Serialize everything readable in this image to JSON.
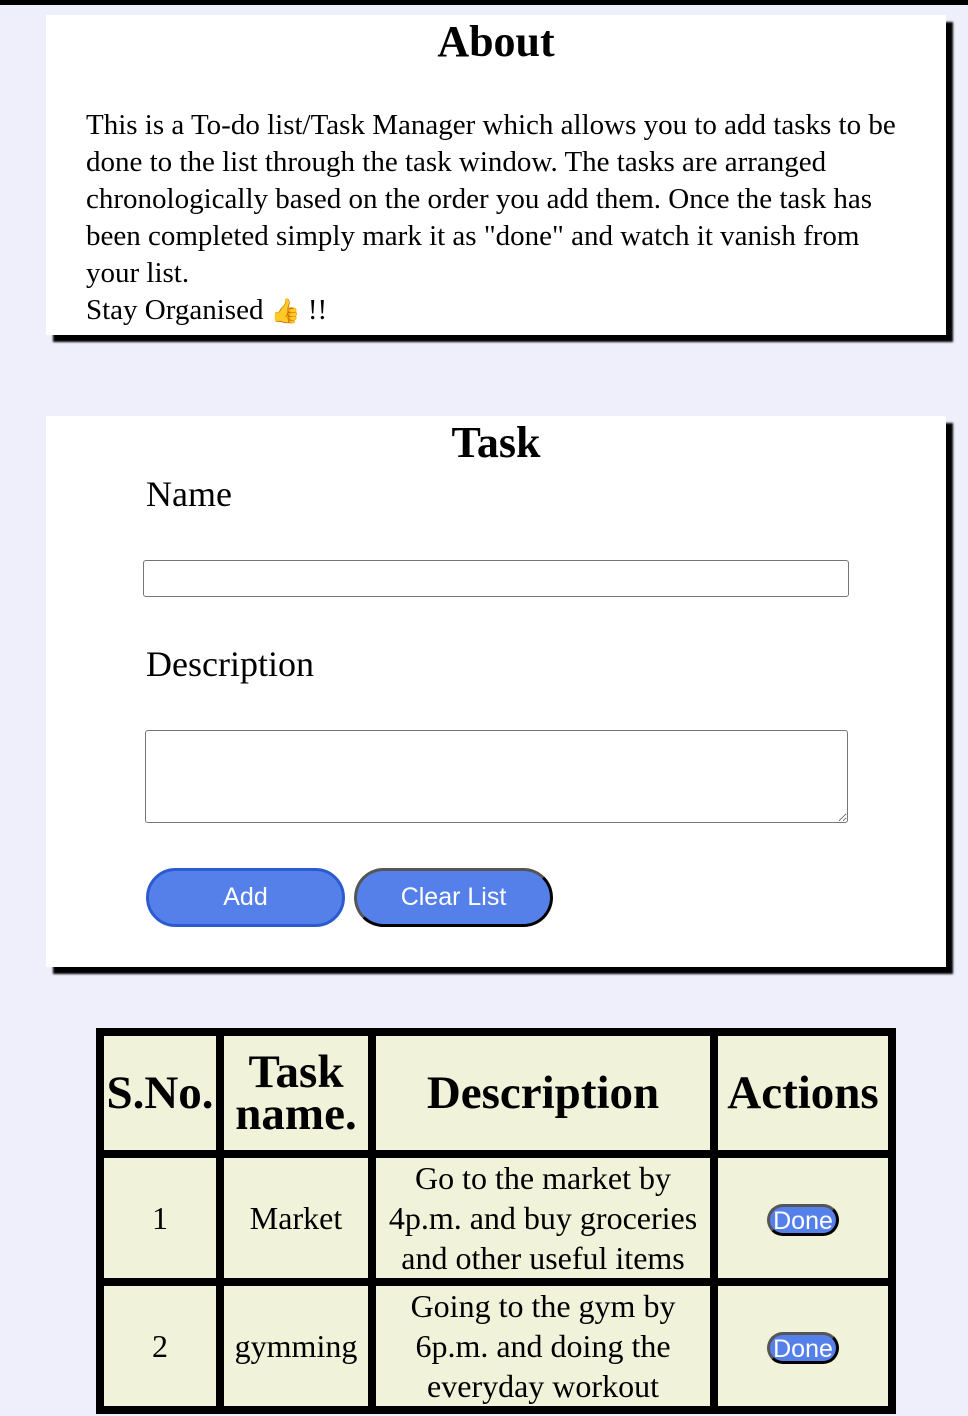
{
  "about": {
    "title": "About",
    "text": "This is a To-do list/Task Manager which allows you to add tasks to be done to the list through the task window. The tasks are arranged chronologically based on the order you add them. Once the task has been completed simply mark it as \"done\" and watch it vanish from your list.",
    "sign_off_before": "Stay Organised",
    "sign_off_emoji": "👍",
    "sign_off_after": "!!"
  },
  "task_form": {
    "title": "Task",
    "name_label": "Name",
    "name_value": "",
    "description_label": "Description",
    "description_value": "",
    "add_label": "Add",
    "clear_label": "Clear List"
  },
  "table": {
    "headers": [
      "S.No.",
      "Task name.",
      "Description",
      "Actions"
    ],
    "rows": [
      {
        "sno": "1",
        "name": "Market",
        "description": "Go to the market by 4p.m. and buy groceries and other useful items",
        "action": "Done"
      },
      {
        "sno": "2",
        "name": "gymming",
        "description": "Going to the gym by 6p.m. and doing the everyday workout",
        "action": "Done"
      }
    ]
  },
  "colors": {
    "page_background": "#efeffc",
    "button_blue": "#5580ea",
    "table_cell": "#f1f2da",
    "table_border": "#000000"
  }
}
